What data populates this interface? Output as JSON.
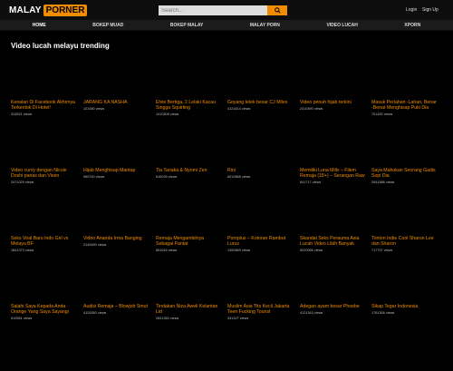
{
  "brand": {
    "part1": "MALAY",
    "part2": "PORNER"
  },
  "search": {
    "placeholder": "Search..."
  },
  "top_links": {
    "login": "Login",
    "signup": "Sign Up"
  },
  "nav": [
    "HOME",
    "BOKEP MUAD",
    "BOKEP MALAY",
    "MALAY PORN",
    "VIDEO LUCAH",
    "XPORN"
  ],
  "section_title": "Video lucah melayu trending",
  "videos": [
    {
      "title": "Kenalan Di Facebook Akhirnya Terkentok Di Hotel!",
      "views": "314521 views"
    },
    {
      "title": "JARANG KA NASHA",
      "views": "101580 views"
    },
    {
      "title": "Elvie Bertiga, 2 Lelaki Kacau Singga Squirting",
      "views": "1410408 views"
    },
    {
      "title": "Goyang telek besar CJ Miles",
      "views": "4121614 views"
    },
    {
      "title": "Video penuh hijab terkini",
      "views": "2410490 views"
    },
    {
      "title": "Masuk Perlahan -Lahan, Benar -Benar Menghisap Puki Dia",
      "views": "701452 views"
    },
    {
      "title": "Video curvy dengan Nicole Doshi panas dan Vixen",
      "views": "2471029 views"
    },
    {
      "title": "Hijab Menghisap Mantap",
      "views": "960740 views"
    },
    {
      "title": "Tia Tanaka & Nyomi Zen",
      "views": "616033 views"
    },
    {
      "title": "Rini",
      "views": "6012868 views"
    },
    {
      "title": "Memiliki Luna Mills – Filem Remaja (18+) – Serangan Raw",
      "views": "841717 views"
    },
    {
      "title": "Saya Mahukan Seorang Gadis Sopi Dia",
      "views": "2841586 views"
    },
    {
      "title": "Seks Viral Baru Indo Girl vs Melayu BF",
      "views": "1841373 views"
    },
    {
      "title": "Video Ananda Irma Banging",
      "views": "2145490 views"
    },
    {
      "title": "Remaja Mengambilnya Sebagai Pantat",
      "views": "861616 views"
    },
    {
      "title": "Pornplus – Kotoran Rambut Lurus",
      "views": "1452869 views"
    },
    {
      "title": "Skandal Seks Perauma Asia Lucah Video Libih Banyak",
      "views": "5020056 views"
    },
    {
      "title": "Tonton Indie Cool Sharon Lee dan Sharon",
      "views": "717707 views"
    },
    {
      "title": "Salahi Saya Kepada Anda Orange Yang Saya Sayangi",
      "views": "610581 views"
    },
    {
      "title": "Audisi Remaja – Blowjob Smut",
      "views": "4120050 views"
    },
    {
      "title": "Tindakan Niza Aweli Kelantan Lid",
      "views": "2841350 views"
    },
    {
      "title": "Muslim Asia Tits Kecil Jakarta Teen Fucking Tourist",
      "views": "341327 views"
    },
    {
      "title": "Adegan ayam besar Phoebe",
      "views": "4121343 views"
    },
    {
      "title": "Sikap Tegar Indonesia",
      "views": "1761306 views"
    }
  ]
}
